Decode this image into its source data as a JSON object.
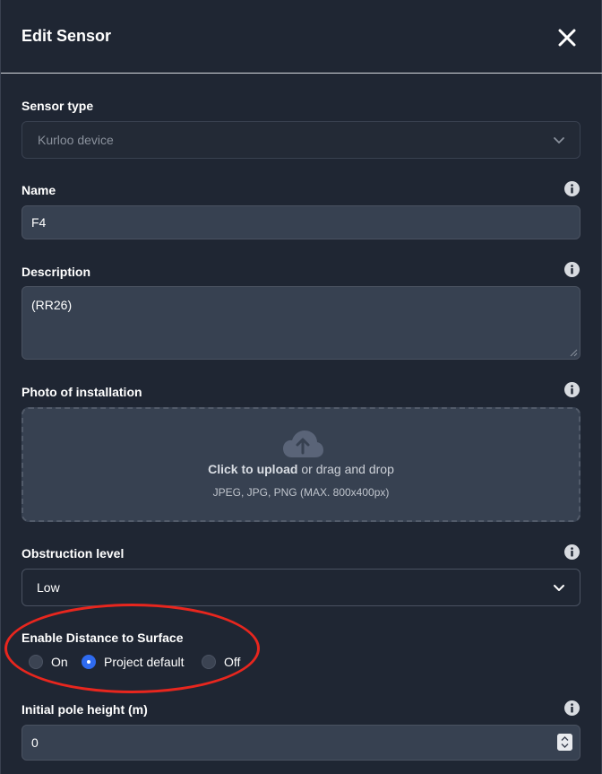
{
  "dialog": {
    "title": "Edit Sensor",
    "close_icon": "close-icon"
  },
  "sensor_type": {
    "label": "Sensor type",
    "value": "Kurloo device"
  },
  "name": {
    "label": "Name",
    "value": "F4"
  },
  "description": {
    "label": "Description",
    "value": "(RR26)"
  },
  "photo": {
    "label": "Photo of installation",
    "upload_strong": "Click to upload",
    "upload_rest": " or drag and drop",
    "hint": "JPEG, JPG, PNG (MAX. 800x400px)"
  },
  "obstruction": {
    "label": "Obstruction level",
    "value": "Low"
  },
  "distance_to_surface": {
    "label": "Enable Distance to Surface",
    "options": [
      {
        "label": "On",
        "selected": false
      },
      {
        "label": "Project default",
        "selected": true
      },
      {
        "label": "Off",
        "selected": false
      }
    ]
  },
  "pole_height": {
    "label": "Initial pole height (m)",
    "value": "0"
  },
  "colors": {
    "background": "#1f2633",
    "input": "#374151",
    "accent": "#2f6bf0",
    "annotation": "#e8261e"
  }
}
